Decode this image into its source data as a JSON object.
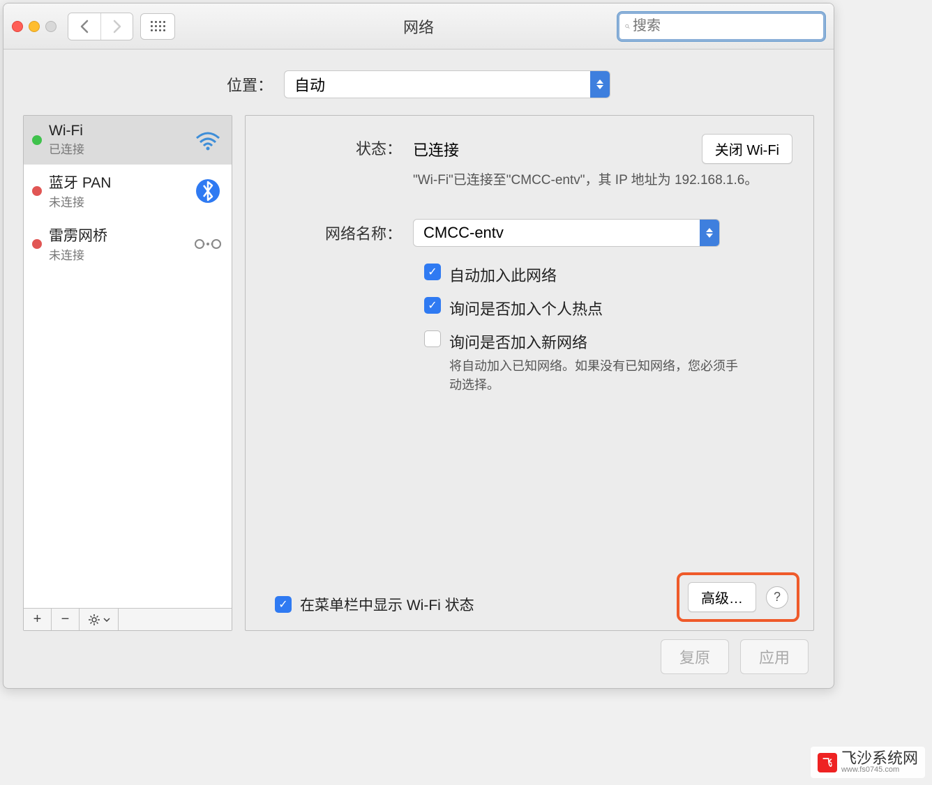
{
  "window": {
    "title": "网络",
    "search_placeholder": "搜索"
  },
  "location": {
    "label": "位置：",
    "value": "自动"
  },
  "sidebar": {
    "items": [
      {
        "title": "Wi-Fi",
        "sub": "已连接",
        "dot": "green",
        "icon": "wifi"
      },
      {
        "title": "蓝牙 PAN",
        "sub": "未连接",
        "dot": "red",
        "icon": "bluetooth"
      },
      {
        "title": "雷雳网桥",
        "sub": "未连接",
        "dot": "red",
        "icon": "thunderbolt"
      }
    ]
  },
  "main": {
    "status_label": "状态：",
    "status_value": "已连接",
    "wifi_off_btn": "关闭 Wi-Fi",
    "status_desc": "\"Wi-Fi\"已连接至\"CMCC-entv\"，其 IP 地址为 192.168.1.6。",
    "network_label": "网络名称：",
    "network_value": "CMCC-entv",
    "auto_join": "自动加入此网络",
    "ask_hotspot": "询问是否加入个人热点",
    "ask_new": "询问是否加入新网络",
    "ask_new_desc": "将自动加入已知网络。如果没有已知网络，您必须手动选择。",
    "menubar_chk": "在菜单栏中显示 Wi-Fi 状态",
    "advanced_btn": "高级…",
    "help": "?"
  },
  "footer": {
    "revert": "复原",
    "apply": "应用"
  },
  "watermark": {
    "badge": "飞",
    "text": "飞沙系统网",
    "url": "www.fs0745.com"
  }
}
